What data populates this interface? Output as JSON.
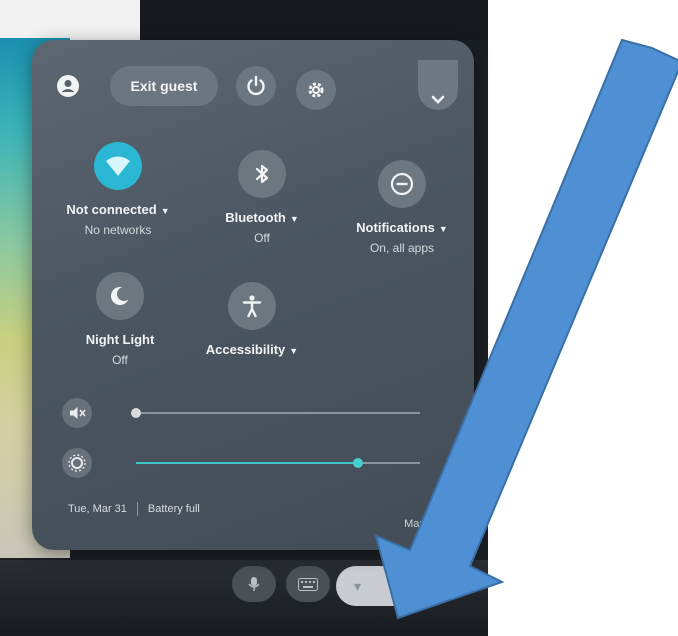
{
  "top_row": {
    "exit_guest_label": "Exit guest"
  },
  "tiles": {
    "wifi": {
      "label": "Not connected",
      "sub": "No networks"
    },
    "bluetooth": {
      "label": "Bluetooth",
      "sub": "Off"
    },
    "notifications": {
      "label": "Notifications",
      "sub": "On, all apps"
    },
    "night_light": {
      "label": "Night Light",
      "sub": "Off"
    },
    "accessibility": {
      "label": "Accessibility",
      "sub": ""
    }
  },
  "sliders": {
    "volume": {
      "level": 0,
      "muted": true
    },
    "brightness": {
      "level": 0.78
    }
  },
  "footer": {
    "date": "Tue, Mar 31",
    "battery": "Battery full",
    "managed": "Managed"
  },
  "colors": {
    "accent": "#2bb7d4",
    "arrow": "#4f8fd4"
  },
  "icons": [
    "account-icon",
    "power-icon",
    "settings-gear-icon",
    "chevron-down-icon",
    "wifi-icon",
    "bluetooth-icon",
    "do-not-disturb-icon",
    "night-light-icon",
    "accessibility-icon",
    "volume-muted-icon",
    "brightness-icon",
    "managed-building-icon",
    "microphone-icon",
    "keyboard-icon",
    "wifi-status-icon"
  ]
}
